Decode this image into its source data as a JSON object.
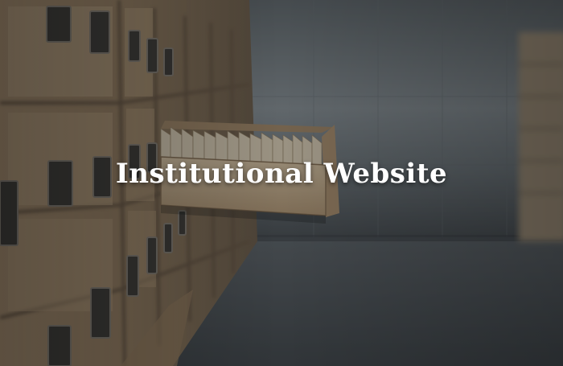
{
  "hero": {
    "title": "Institutional Website",
    "title_color": "#ffffff",
    "image_subject": "wooden card catalog drawers in an archive room with one drawer pulled open",
    "palette": {
      "wall": "#7d848a",
      "floor": "#4f5357",
      "wood_light": "#d8bf9c",
      "wood_dark": "#8a6e4f",
      "overlay": "#1e2125"
    }
  }
}
